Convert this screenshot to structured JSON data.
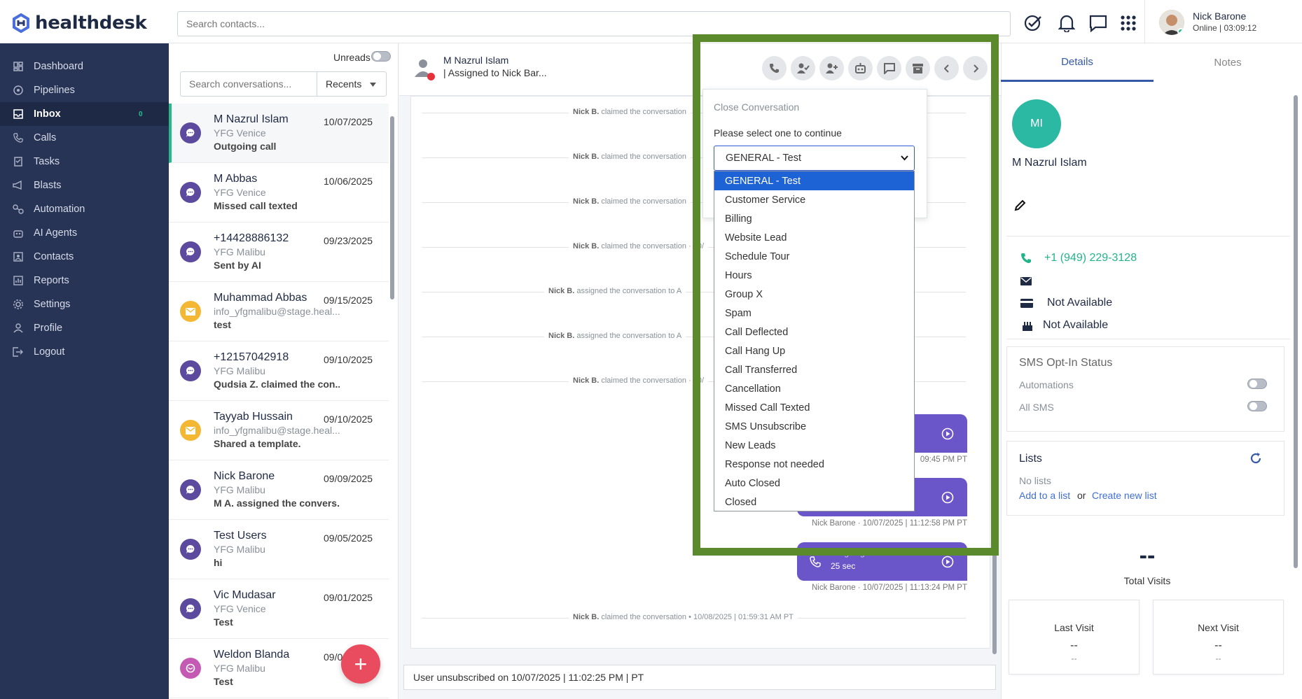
{
  "app": {
    "logo": "healthdesk"
  },
  "topbar": {
    "search_placeholder": "Search contacts...",
    "user_name": "Nick Barone",
    "user_status": "Online  |  03:09:12"
  },
  "sidebar": {
    "items": [
      {
        "label": "Dashboard",
        "icon": "dashboard-icon"
      },
      {
        "label": "Pipelines",
        "icon": "pipelines-icon"
      },
      {
        "label": "Inbox",
        "icon": "inbox-icon",
        "badge": "0"
      },
      {
        "label": "Calls",
        "icon": "phone-icon"
      },
      {
        "label": "Tasks",
        "icon": "tasks-icon"
      },
      {
        "label": "Blasts",
        "icon": "megaphone-icon"
      },
      {
        "label": "Automation",
        "icon": "automation-icon"
      },
      {
        "label": "AI Agents",
        "icon": "robot-icon"
      },
      {
        "label": "Contacts",
        "icon": "contacts-icon"
      },
      {
        "label": "Reports",
        "icon": "reports-icon"
      },
      {
        "label": "Settings",
        "icon": "gear-icon"
      },
      {
        "label": "Profile",
        "icon": "user-icon"
      },
      {
        "label": "Logout",
        "icon": "logout-icon"
      }
    ]
  },
  "inbox": {
    "unreads_label": "Unreads",
    "search_placeholder": "Search conversations...",
    "filter_label": "Recents",
    "conversations": [
      {
        "name": "M Nazrul Islam",
        "date": "10/07/2025",
        "location": "YFG Venice",
        "last": "Outgoing call",
        "type": "chat"
      },
      {
        "name": "M Abbas",
        "date": "10/06/2025",
        "location": "YFG Venice",
        "last": "Missed call texted",
        "type": "chat"
      },
      {
        "name": "+14428886132",
        "date": "09/23/2025",
        "location": "YFG Malibu",
        "last": "Sent by AI",
        "type": "chat"
      },
      {
        "name": "Muhammad Abbas",
        "date": "09/15/2025",
        "location": "info_yfgmalibu@stage.heal...",
        "last": "test",
        "type": "email"
      },
      {
        "name": "+12157042918",
        "date": "09/10/2025",
        "location": "YFG Malibu",
        "last": "Qudsia Z. claimed the con...",
        "type": "chat"
      },
      {
        "name": "Tayyab Hussain",
        "date": "09/10/2025",
        "location": "info_yfgmalibu@stage.heal...",
        "last": "Shared a template.",
        "type": "email"
      },
      {
        "name": "Nick Barone",
        "date": "09/09/2025",
        "location": "YFG Malibu",
        "last": "M A. assigned the convers...",
        "type": "chat"
      },
      {
        "name": "Test Users",
        "date": "09/05/2025",
        "location": "YFG Malibu",
        "last": "hi",
        "type": "chat"
      },
      {
        "name": "Vic Mudasar",
        "date": "09/01/2025",
        "location": "YFG Venice",
        "last": "Test",
        "type": "chat"
      },
      {
        "name": "Weldon Blanda",
        "date": "09/0",
        "location": "YFG Malibu",
        "last": "Test",
        "type": "web"
      }
    ],
    "fab_label": "+"
  },
  "chat": {
    "contact_name": "M Nazrul Islam",
    "assigned": "| Assigned to Nick Bar...",
    "events": [
      {
        "actor": "Nick B.",
        "text": "claimed the conversation"
      },
      {
        "actor": "Nick B.",
        "text": "claimed the conversation"
      },
      {
        "actor": "Nick B.",
        "text": "claimed the conversation"
      },
      {
        "actor": "Nick B.",
        "text": "claimed the conversation · 10/"
      },
      {
        "actor": "Nick B.",
        "text": "assigned the conversation to A"
      },
      {
        "actor": "Nick B.",
        "text": "assigned the conversation to A"
      },
      {
        "actor": "Nick B.",
        "text": "claimed the conversation · 10/"
      },
      {
        "actor": "Nick B.",
        "text": "claimed the conversation • 10/08/2025 | 01:59:31 AM PT"
      }
    ],
    "messages": [
      {
        "label": "",
        "duration": "",
        "meta": "09:45 PM PT"
      },
      {
        "label": "",
        "duration": "",
        "meta": "Nick Barone · 10/07/2025 | 11:12:58 PM PT"
      },
      {
        "label": "Outgoing call",
        "duration": "25 sec",
        "meta": "Nick Barone · 10/07/2025 | 11:13:24 PM PT"
      }
    ],
    "composer_text": "User unsubscribed on 10/07/2025 | 11:02:25 PM | PT"
  },
  "close_dialog": {
    "title": "Close Conversation",
    "subtitle": "Please select one to continue",
    "selected": "GENERAL - Test",
    "options": [
      "GENERAL - Test",
      "Customer Service",
      "Billing",
      "Website Lead",
      "Schedule Tour",
      "Hours",
      "Group X",
      "Spam",
      "Call Deflected",
      "Call Hang Up",
      "Call Transferred",
      "Cancellation",
      "Missed Call Texted",
      "SMS Unsubscribe",
      "New Leads",
      "Response not needed",
      "Auto Closed",
      "Closed"
    ]
  },
  "details": {
    "tabs": [
      "Details",
      "Notes"
    ],
    "initials": "MI",
    "name": "M Nazrul Islam",
    "phone": "+1 (949) 229-3128",
    "card_info": "Not Available",
    "birthday": "Not Available",
    "sms_optin": {
      "title": "SMS Opt-In Status",
      "automations": "Automations",
      "all_sms": "All SMS"
    },
    "lists": {
      "title": "Lists",
      "empty": "No lists",
      "add": "Add to a list",
      "or": "or",
      "create": "Create new list"
    },
    "visits": {
      "total_value": "--",
      "total_label": "Total Visits",
      "last_label": "Last Visit",
      "last_value": "--",
      "last_sub": "--",
      "next_label": "Next Visit",
      "next_value": "--",
      "next_sub": "--"
    }
  },
  "colors": {
    "sidebar": "#273456",
    "accent": "#6a55c9",
    "frame": "#5a8a2c",
    "select": "#1e63d6",
    "teal": "#2bb9a3"
  }
}
